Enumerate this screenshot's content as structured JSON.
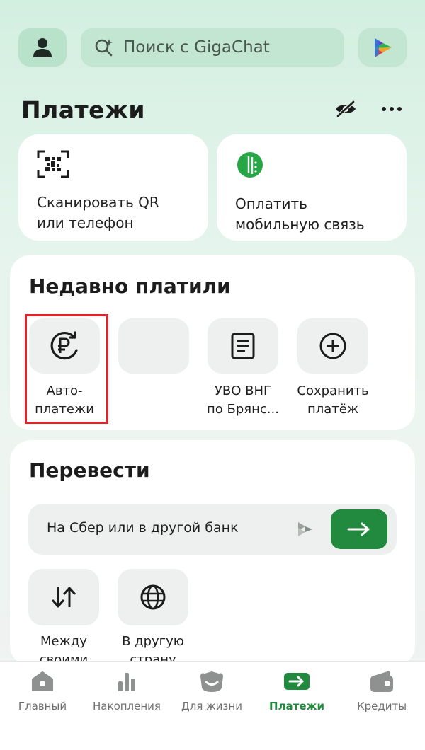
{
  "search": {
    "placeholder": "Поиск с GigaChat"
  },
  "header": {
    "title": "Платежи"
  },
  "quick_actions": [
    {
      "label_line1": "Сканировать QR",
      "label_line2": "или телефон"
    },
    {
      "label_line1": "Оплатить",
      "label_line2": "мобильную связь"
    }
  ],
  "recent": {
    "title": "Недавно платили",
    "items": [
      {
        "line1": "Авто-",
        "line2": "платежи"
      },
      {
        "line1": "",
        "line2": ""
      },
      {
        "line1": "УВО ВНГ",
        "line2": "по Брянс..."
      },
      {
        "line1": "Сохранить",
        "line2": "платёж"
      }
    ]
  },
  "transfer": {
    "title": "Перевести",
    "bank_row": "На Сбер или в другой банк",
    "items": [
      {
        "line1": "Между",
        "line2": "своими"
      },
      {
        "line1": "В другую",
        "line2": "страну"
      }
    ]
  },
  "bottom_nav": [
    {
      "label": "Главный",
      "icon": "home-icon"
    },
    {
      "label": "Накопления",
      "icon": "savings-icon"
    },
    {
      "label": "Для жизни",
      "icon": "life-icon"
    },
    {
      "label": "Платежи",
      "icon": "payments-icon",
      "active": true
    },
    {
      "label": "Кредиты",
      "icon": "credits-icon"
    }
  ],
  "colors": {
    "accent": "#218a3e",
    "highlight": "#e0242a",
    "background": "#d3efe0"
  }
}
